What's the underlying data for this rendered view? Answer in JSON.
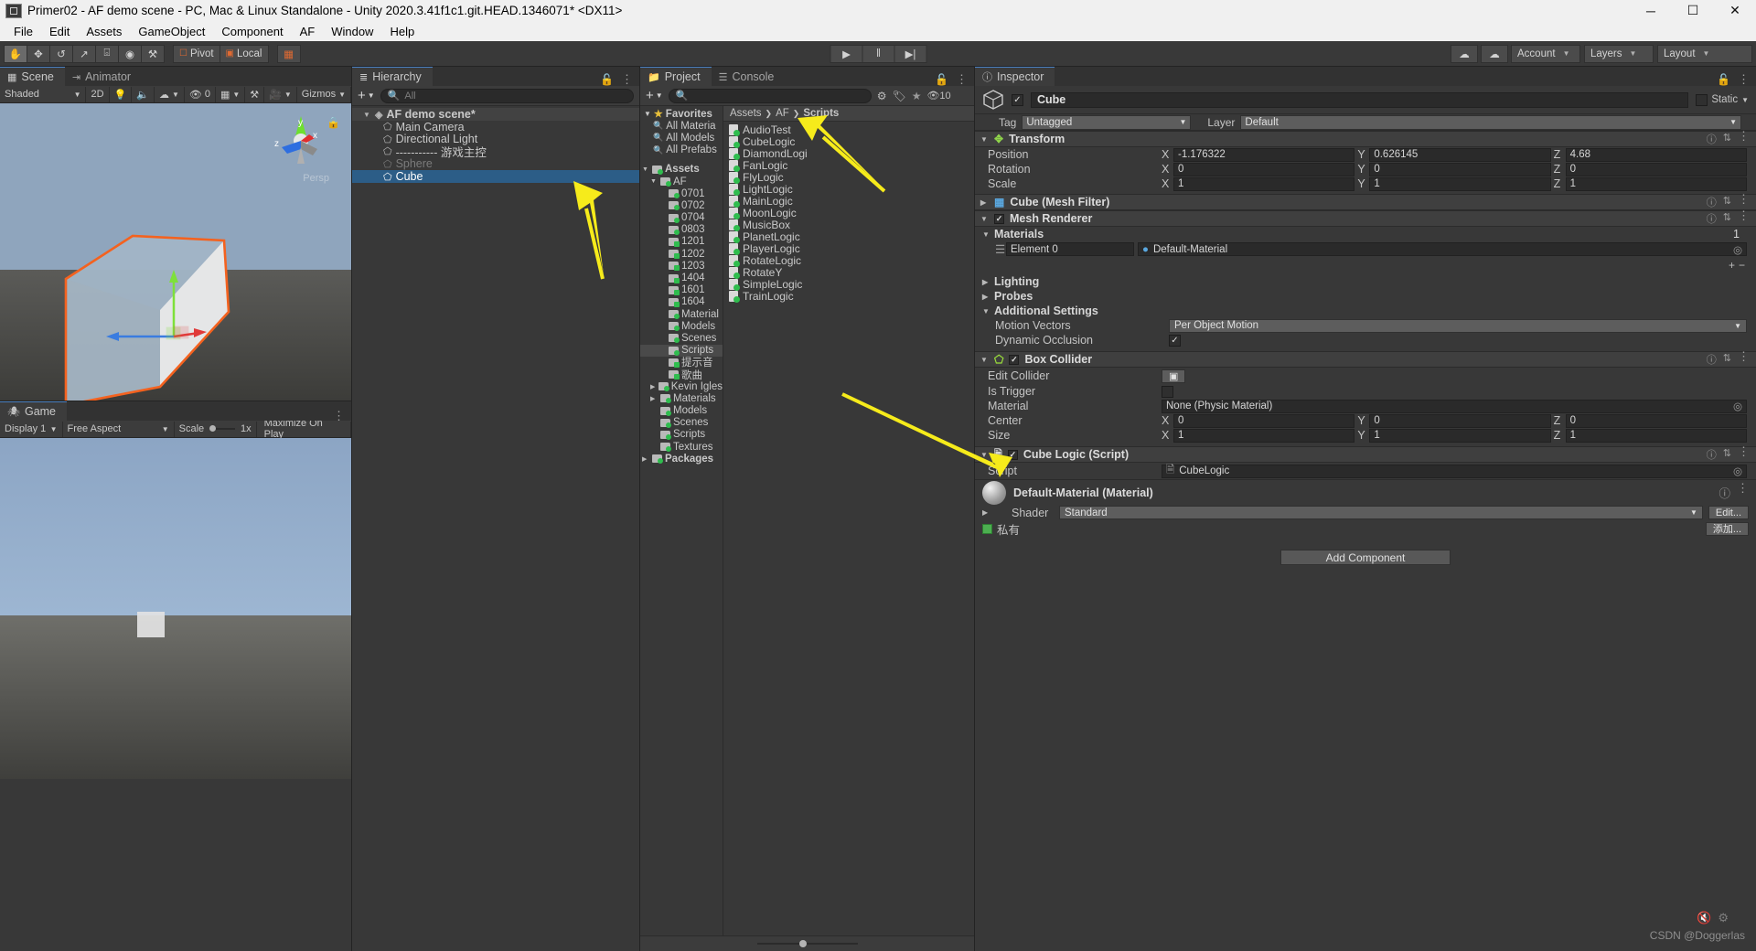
{
  "window": {
    "title": "Primer02 - AF demo scene - PC, Mac & Linux Standalone - Unity 2020.3.41f1c1.git.HEAD.1346071* <DX11>",
    "minimize": "─",
    "maximize": "☐",
    "close": "✕"
  },
  "menu": {
    "items": [
      "File",
      "Edit",
      "Assets",
      "GameObject",
      "Component",
      "AF",
      "Window",
      "Help"
    ]
  },
  "toolbar": {
    "transform_tools": [
      "hand-tool",
      "move-tool",
      "rotate-tool",
      "scale-tool",
      "rect-tool",
      "transform-tool",
      "custom-tool"
    ],
    "pivot_label": "Pivot",
    "local_label": "Local",
    "grid_label": "grid-snap",
    "play": "▶",
    "pause": "‖",
    "step": "▶|",
    "collab": "collab-icon",
    "cloud": "cloud-icon",
    "account_label": "Account",
    "layers_label": "Layers",
    "layout_label": "Layout"
  },
  "scene_panel": {
    "tabs": [
      {
        "label": "Scene",
        "icon": "grid-icon",
        "active": true
      },
      {
        "label": "Animator",
        "icon": "animator-icon",
        "active": false
      }
    ],
    "controls": {
      "draw_mode": "Shaded",
      "two_d": "2D",
      "lighting": "light-icon",
      "audio": "audio-icon",
      "fx": "fx-icon",
      "hidden_count": "0",
      "grid": "grid-icon",
      "tools": "tools-icon",
      "camera": "camera-icon",
      "gizmos": "Gizmos"
    },
    "gizmo_axes": {
      "y": "y",
      "x": "x",
      "z": "z"
    },
    "persp_label": "Persp"
  },
  "game_panel": {
    "tab": "Game",
    "display": "Display 1",
    "aspect": "Free Aspect",
    "scale_label": "Scale",
    "scale_value": "1x",
    "maximize": "Maximize On Play"
  },
  "hierarchy": {
    "tab": "Hierarchy",
    "search_placeholder": "All",
    "add_label": "+",
    "items": [
      {
        "label": "AF demo scene*",
        "depth": 0,
        "type": "scene",
        "selected": false,
        "expanded": true
      },
      {
        "label": "Main Camera",
        "depth": 1,
        "type": "gameobject",
        "selected": false
      },
      {
        "label": "Directional Light",
        "depth": 1,
        "type": "gameobject",
        "selected": false
      },
      {
        "label": "----------- 游戏主控",
        "depth": 1,
        "type": "gameobject",
        "selected": false
      },
      {
        "label": "Sphere",
        "depth": 1,
        "type": "gameobject",
        "selected": false,
        "disabled": true
      },
      {
        "label": "Cube",
        "depth": 1,
        "type": "gameobject",
        "selected": true
      }
    ]
  },
  "project": {
    "tabs": [
      {
        "label": "Project",
        "active": true
      },
      {
        "label": "Console",
        "active": false
      }
    ],
    "search_placeholder": "",
    "icon_count": "10",
    "favorites_label": "Favorites",
    "favorites": [
      "All Materia",
      "All Models",
      "All Prefabs"
    ],
    "tree": [
      {
        "label": "Assets",
        "depth": 0,
        "expanded": true,
        "kind": "folder"
      },
      {
        "label": "AF",
        "depth": 1,
        "expanded": true,
        "kind": "folder"
      },
      {
        "label": "0701",
        "depth": 2,
        "kind": "folder"
      },
      {
        "label": "0702",
        "depth": 2,
        "kind": "folder"
      },
      {
        "label": "0704",
        "depth": 2,
        "kind": "folder"
      },
      {
        "label": "0803",
        "depth": 2,
        "kind": "folder"
      },
      {
        "label": "1201",
        "depth": 2,
        "kind": "folder-sq"
      },
      {
        "label": "1202",
        "depth": 2,
        "kind": "folder-sq"
      },
      {
        "label": "1203",
        "depth": 2,
        "kind": "folder-sq"
      },
      {
        "label": "1404",
        "depth": 2,
        "kind": "folder-sq"
      },
      {
        "label": "1601",
        "depth": 2,
        "kind": "folder-sq"
      },
      {
        "label": "1604",
        "depth": 2,
        "kind": "folder-sq"
      },
      {
        "label": "Material",
        "depth": 2,
        "kind": "folder"
      },
      {
        "label": "Models",
        "depth": 2,
        "kind": "folder"
      },
      {
        "label": "Scenes",
        "depth": 2,
        "kind": "folder"
      },
      {
        "label": "Scripts",
        "depth": 2,
        "kind": "folder",
        "selected": true
      },
      {
        "label": "提示音",
        "depth": 2,
        "kind": "folder-sq"
      },
      {
        "label": "歌曲",
        "depth": 2,
        "kind": "folder-sq"
      },
      {
        "label": "Kevin Igles",
        "depth": 1,
        "kind": "folder",
        "collapsed": true
      },
      {
        "label": "Materials",
        "depth": 1,
        "kind": "folder",
        "collapsed": true
      },
      {
        "label": "Models",
        "depth": 1,
        "kind": "folder"
      },
      {
        "label": "Scenes",
        "depth": 1,
        "kind": "folder"
      },
      {
        "label": "Scripts",
        "depth": 1,
        "kind": "folder"
      },
      {
        "label": "Textures",
        "depth": 1,
        "kind": "folder"
      },
      {
        "label": "Packages",
        "depth": 0,
        "kind": "folder-plain",
        "collapsed": true
      }
    ],
    "breadcrumb": [
      "Assets",
      "AF",
      "Scripts"
    ],
    "assets": [
      "AudioTest",
      "CubeLogic",
      "DiamondLogi",
      "FanLogic",
      "FlyLogic",
      "LightLogic",
      "MainLogic",
      "MoonLogic",
      "MusicBox",
      "PlanetLogic",
      "PlayerLogic",
      "RotateLogic",
      "RotateY",
      "SimpleLogic",
      "TrainLogic"
    ]
  },
  "inspector": {
    "tab": "Inspector",
    "object_name": "Cube",
    "static_label": "Static",
    "tag_label": "Tag",
    "tag_value": "Untagged",
    "layer_label": "Layer",
    "layer_value": "Default",
    "transform": {
      "title": "Transform",
      "rows": [
        {
          "label": "Position",
          "x": "-1.176322",
          "y": "0.626145",
          "z": "4.68"
        },
        {
          "label": "Rotation",
          "x": "0",
          "y": "0",
          "z": "0"
        },
        {
          "label": "Scale",
          "x": "1",
          "y": "1",
          "z": "1"
        }
      ]
    },
    "mesh_filter": {
      "title": "Cube (Mesh Filter)"
    },
    "mesh_renderer": {
      "title": "Mesh Renderer",
      "materials_label": "Materials",
      "materials_count": "1",
      "element_label": "Element 0",
      "element_value": "Default-Material",
      "lighting_label": "Lighting",
      "probes_label": "Probes",
      "additional_label": "Additional Settings",
      "motion_vectors_label": "Motion Vectors",
      "motion_vectors_value": "Per Object Motion",
      "dynamic_occlusion_label": "Dynamic Occlusion"
    },
    "box_collider": {
      "title": "Box Collider",
      "edit_collider_label": "Edit Collider",
      "is_trigger_label": "Is Trigger",
      "material_label": "Material",
      "material_value": "None (Physic Material)",
      "center_label": "Center",
      "center": {
        "x": "0",
        "y": "0",
        "z": "0"
      },
      "size_label": "Size",
      "size": {
        "x": "1",
        "y": "1",
        "z": "1"
      }
    },
    "cube_logic": {
      "title": "Cube Logic (Script)",
      "script_label": "Script",
      "script_value": "CubeLogic"
    },
    "material_preview": {
      "title": "Default-Material (Material)",
      "shader_label": "Shader",
      "shader_value": "Standard",
      "edit_label": "Edit...",
      "private_label": "私有",
      "add_label": "添加..."
    },
    "add_component": "Add Component"
  },
  "watermark": "CSDN @Doggerlas",
  "colors": {
    "accent_blue": "#2c5d87",
    "selection_orange": "#f4621f",
    "arrow_yellow": "#f6eb1b",
    "green": "#2fbd4e"
  }
}
